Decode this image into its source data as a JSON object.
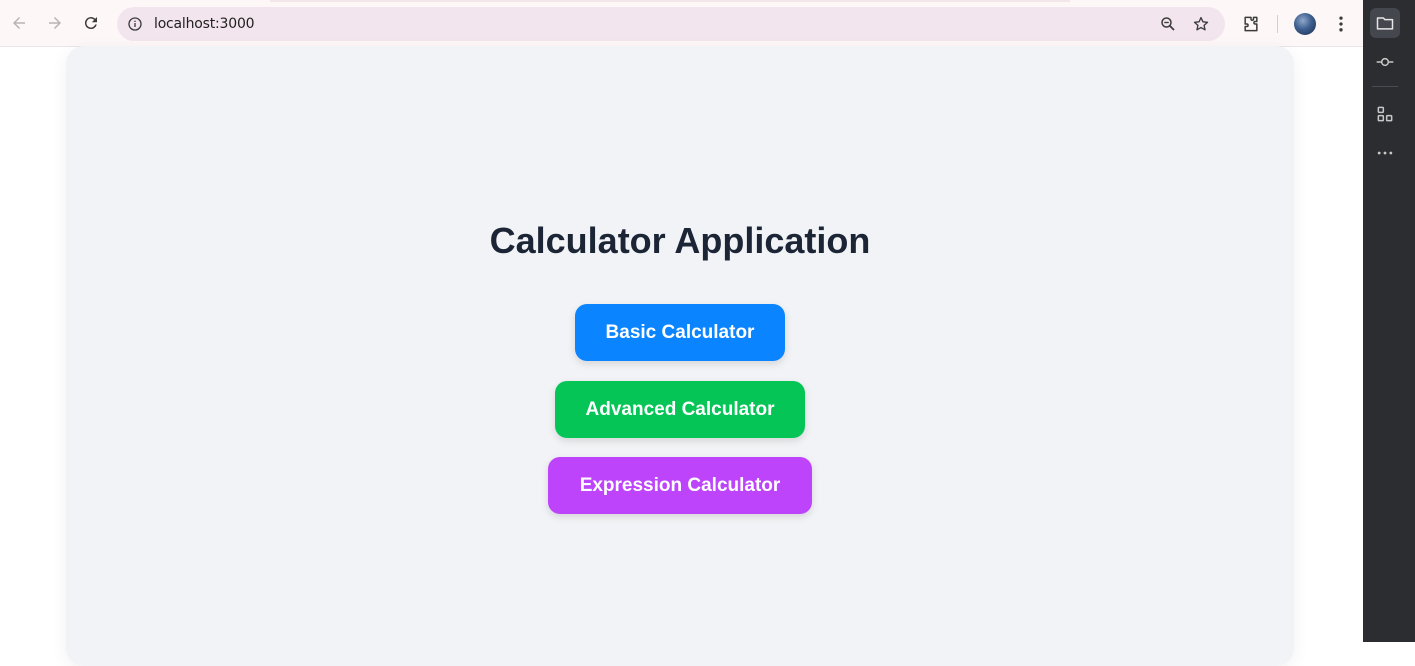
{
  "browser": {
    "url": "localhost:3000"
  },
  "page": {
    "title": "Calculator Application",
    "buttons": [
      {
        "label": "Basic Calculator",
        "color": "#0a84ff"
      },
      {
        "label": "Advanced Calculator",
        "color": "#04c556"
      },
      {
        "label": "Expression Calculator",
        "color": "#bd44fb"
      }
    ]
  },
  "icons": {
    "back": "arrow-left-icon",
    "forward": "arrow-right-icon",
    "reload": "reload-icon",
    "site_info": "info-icon",
    "zoom": "zoom-icon",
    "bookmark": "star-icon",
    "extensions": "puzzle-icon",
    "profile": "avatar",
    "menu": "more-vertical-icon",
    "side_panel": [
      "folder-icon",
      "commit-icon",
      "apps-icon",
      "more-horizontal-icon"
    ]
  },
  "colors": {
    "title": "#1b2535",
    "card_background": "#f2f3f6",
    "side_panel": "#2b2d31"
  }
}
